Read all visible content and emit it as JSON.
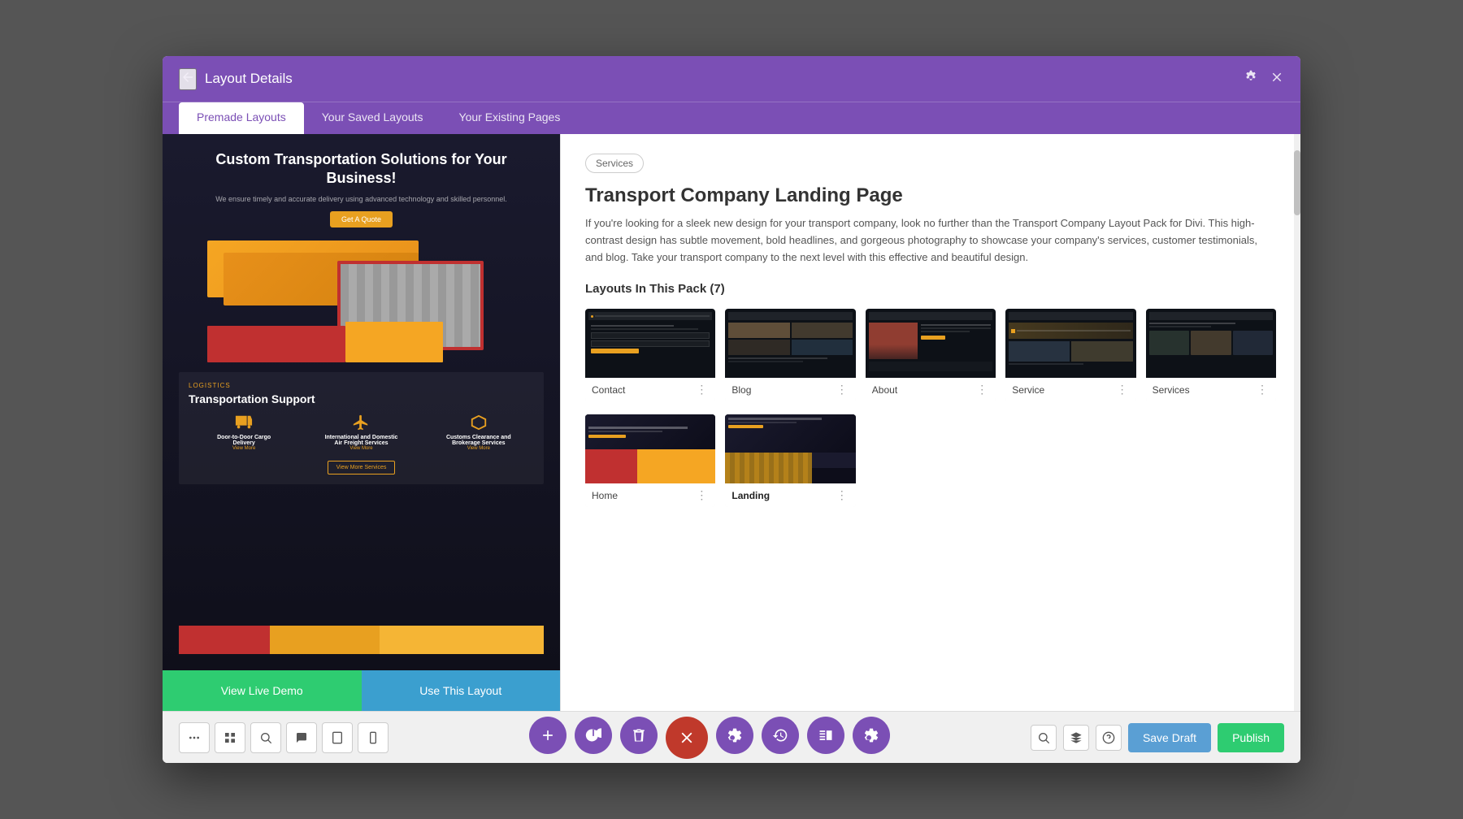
{
  "modal": {
    "title": "Layout Details",
    "tabs": [
      {
        "label": "Premade Layouts",
        "active": true
      },
      {
        "label": "Your Saved Layouts",
        "active": false
      },
      {
        "label": "Your Existing Pages",
        "active": false
      }
    ]
  },
  "preview": {
    "hero_title": "Custom Transportation Solutions for Your Business!",
    "hero_subtitle": "We ensure timely and accurate delivery using advanced technology and skilled personnel.",
    "hero_cta": "Get A Quote",
    "section_label": "LOGISTICS",
    "section_title": "Transportation Support",
    "services": [
      {
        "title": "Door-to-Door Cargo Delivery",
        "link": "View More"
      },
      {
        "title": "International and Domestic Air Freight Services",
        "link": "View More"
      },
      {
        "title": "Customs Clearance and Brokerage Services",
        "link": "View More"
      }
    ],
    "view_btn": "View More Services",
    "demo_btn": "View Live Demo",
    "use_btn": "Use This Layout"
  },
  "detail": {
    "category": "Services",
    "title": "Transport Company Landing Page",
    "description": "If you're looking for a sleek new design for your transport company, look no further than the Transport Company Layout Pack for Divi. This high-contrast design has subtle movement, bold headlines, and gorgeous photography to showcase your company's services, customer testimonials, and blog. Take your transport company to the next level with this effective and beautiful design.",
    "pack_label": "Layouts In This Pack (7)",
    "layouts": [
      {
        "name": "Contact",
        "bold": false
      },
      {
        "name": "Blog",
        "bold": false
      },
      {
        "name": "About",
        "bold": false
      },
      {
        "name": "Service",
        "bold": false
      },
      {
        "name": "Services",
        "bold": false
      },
      {
        "name": "Home",
        "bold": false
      },
      {
        "name": "Landing",
        "bold": true
      }
    ]
  },
  "toolbar": {
    "save_draft": "Save Draft",
    "publish": "Publish"
  }
}
